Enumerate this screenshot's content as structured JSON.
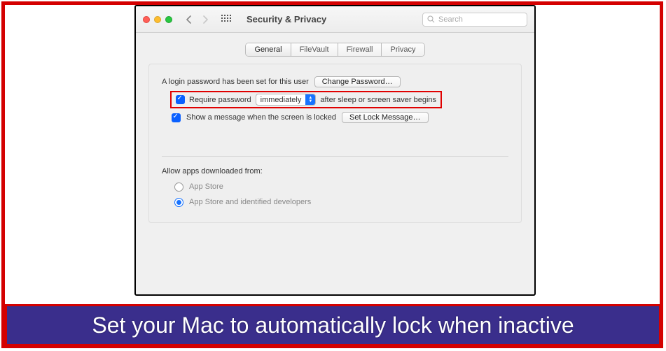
{
  "toolbar": {
    "title": "Security & Privacy",
    "search_placeholder": "Search"
  },
  "tabs": {
    "general": "General",
    "filevault": "FileVault",
    "firewall": "Firewall",
    "privacy": "Privacy"
  },
  "general": {
    "login_text": "A login password has been set for this user",
    "change_password_btn": "Change Password…",
    "require_password_label": "Require password",
    "delay_value": "immediately",
    "after_sleep_text": "after sleep or screen saver begins",
    "show_message_label": "Show a message when the screen is locked",
    "set_lock_message_btn": "Set Lock Message…",
    "allow_apps_heading": "Allow apps downloaded from:",
    "opt_app_store": "App Store",
    "opt_identified": "App Store and identified developers"
  },
  "caption": "Set your Mac to automatically lock when inactive"
}
